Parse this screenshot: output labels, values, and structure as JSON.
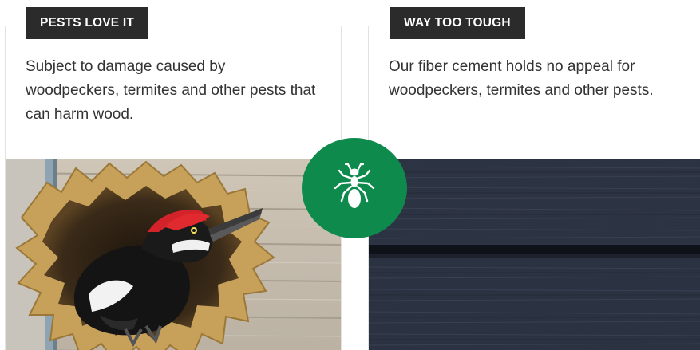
{
  "left_panel": {
    "badge": "PESTS LOVE IT",
    "description": "Subject to damage caused by woodpeckers, termites and other pests that can harm wood.",
    "image_icon": "woodpecker-in-siding-photo"
  },
  "right_panel": {
    "badge": "WAY TOO TOUGH",
    "description": "Our fiber cement holds no appeal for woodpeckers, termites and other pests.",
    "image_icon": "fiber-cement-siding-photo"
  },
  "center_emblem": {
    "icon": "ant-icon",
    "color": "#0e8a4c"
  },
  "colors": {
    "badge_background": "#2b2b2b",
    "emblem_green": "#0e8a4c",
    "siding_dark": "#2a3140"
  }
}
